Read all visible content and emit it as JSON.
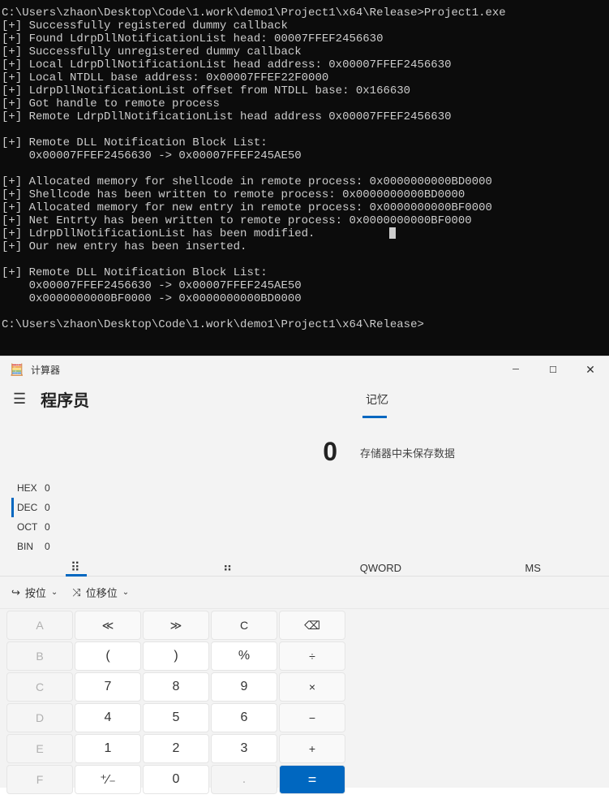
{
  "terminal": {
    "prompt1": "C:\\Users\\zhaon\\Desktop\\Code\\1.work\\demo1\\Project1\\x64\\Release>Project1.exe",
    "lines": [
      "[+] Successfully registered dummy callback",
      "[+] Found LdrpDllNotificationList head: 00007FFEF2456630",
      "[+] Successfully unregistered dummy callback",
      "[+] Local LdrpDllNotificationList head address: 0x00007FFEF2456630",
      "[+] Local NTDLL base address: 0x00007FFEF22F0000",
      "[+] LdrpDllNotificationList offset from NTDLL base: 0x166630",
      "[+] Got handle to remote process",
      "[+] Remote LdrpDllNotificationList head address 0x00007FFEF2456630",
      "",
      "[+] Remote DLL Notification Block List:",
      "    0x00007FFEF2456630 -> 0x00007FFEF245AE50",
      "",
      "[+] Allocated memory for shellcode in remote process: 0x0000000000BD0000",
      "[+] Shellcode has been written to remote process: 0x0000000000BD0000",
      "[+] Allocated memory for new entry in remote process: 0x0000000000BF0000",
      "[+] Net Entrty has been written to remote process: 0x0000000000BF0000",
      "[+] LdrpDllNotificationList has been modified.",
      "[+] Our new entry has been inserted.",
      "",
      "[+] Remote DLL Notification Block List:",
      "    0x00007FFEF2456630 -> 0x00007FFEF245AE50",
      "    0x0000000000BF0000 -> 0x0000000000BD0000",
      ""
    ],
    "prompt2": "C:\\Users\\zhaon\\Desktop\\Code\\1.work\\demo1\\Project1\\x64\\Release>"
  },
  "calc": {
    "app_icon": "🧮",
    "title": "计算器",
    "mode": "程序员",
    "memory_label": "记忆",
    "memory_empty": "存储器中未保存数据",
    "display": "0",
    "bases": {
      "hex_lbl": "HEX",
      "hex_val": "0",
      "dec_lbl": "DEC",
      "dec_val": "0",
      "oct_lbl": "OCT",
      "oct_val": "0",
      "bin_lbl": "BIN",
      "bin_val": "0"
    },
    "tabs": {
      "keypad_icon": "⠿",
      "bit_icon": "⠶",
      "qword": "QWORD",
      "ms": "MS"
    },
    "opts": {
      "bitwise_icon": "↪",
      "bitwise": "按位",
      "shift_icon": "⤨",
      "shift": "位移位"
    },
    "keys": {
      "a": "A",
      "lsh": "≪",
      "rsh": "≫",
      "c": "C",
      "bsp": "⌫",
      "b": "B",
      "lp": "(",
      "rp": ")",
      "pct": "%",
      "div": "÷",
      "cc": "C",
      "n7": "7",
      "n8": "8",
      "n9": "9",
      "mul": "×",
      "d": "D",
      "n4": "4",
      "n5": "5",
      "n6": "6",
      "sub": "−",
      "e": "E",
      "n1": "1",
      "n2": "2",
      "n3": "3",
      "add": "+",
      "f": "F",
      "neg": "⁺∕₋",
      "n0": "0",
      "dot": ".",
      "eq": "="
    }
  }
}
